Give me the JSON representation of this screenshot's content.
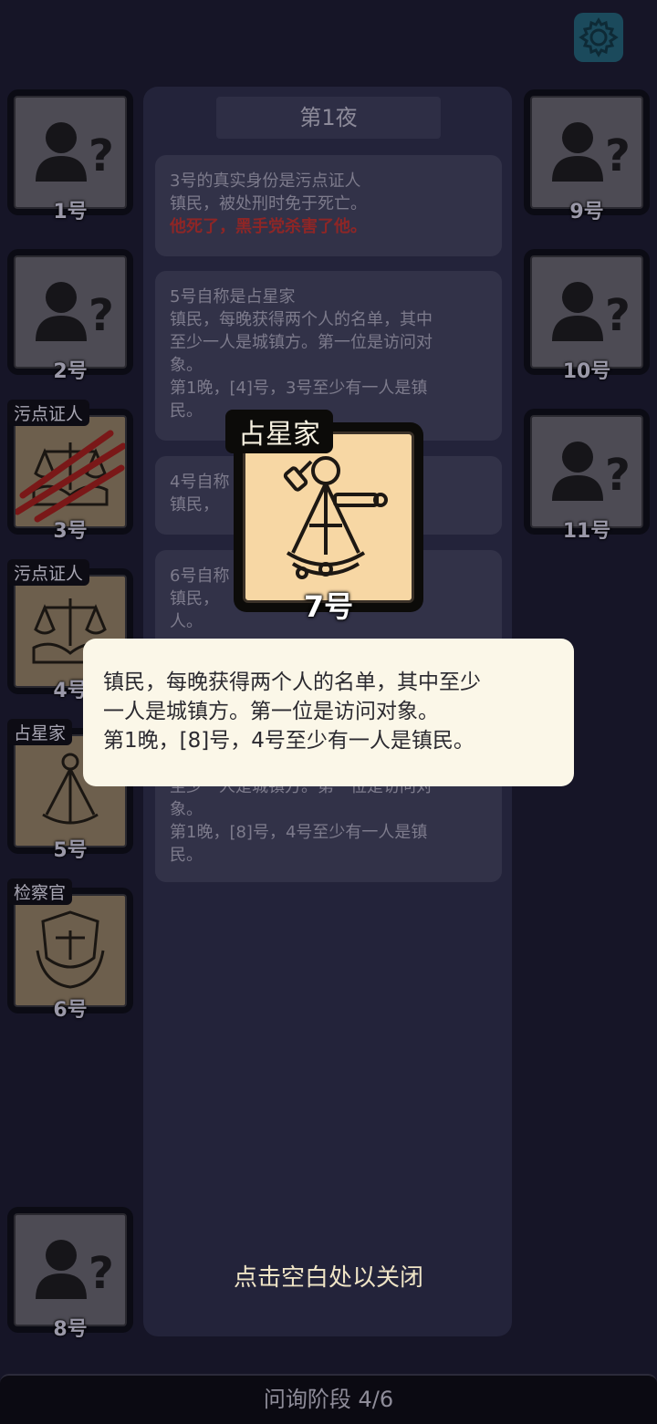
{
  "settings": {
    "icon": "gear-icon",
    "color": "#1b4a5c"
  },
  "night_title": "第1夜",
  "messages": [
    {
      "lines": [
        "3号的真实身份是污点证人",
        "镇民，被处刑时免于死亡。"
      ],
      "highlight": "他死了，黑手党杀害了他。"
    },
    {
      "lines": [
        "5号自称是占星家",
        "镇民，每晚获得两个人的名单，其中",
        "至少一人是城镇方。第一位是访问对",
        "象。",
        "第1晚，[4]号，3号至少有一人是镇",
        "民。"
      ]
    },
    {
      "lines": [
        "4号自称",
        "镇民，"
      ]
    },
    {
      "lines": [
        "6号自称",
        "镇民，",
        "人。"
      ]
    },
    {
      "lines": [
        "至少一人是城镇方。第一位是访问对",
        "象。",
        "第1晚，[8]号，4号至少有一人是镇",
        "民。"
      ]
    }
  ],
  "players": {
    "p1": {
      "num": "1号",
      "icon": "unknown-player-icon"
    },
    "p2": {
      "num": "2号",
      "icon": "unknown-player-icon"
    },
    "p3": {
      "num": "3号",
      "role": "污点证人",
      "icon": "witness-icon",
      "status": "dead"
    },
    "p4": {
      "num": "4号",
      "role": "污点证人",
      "icon": "witness-icon"
    },
    "p5": {
      "num": "5号",
      "role": "占星家",
      "icon": "sextant-icon"
    },
    "p6": {
      "num": "6号",
      "role": "检察官",
      "icon": "prosecutor-icon"
    },
    "p8": {
      "num": "8号",
      "icon": "unknown-player-icon"
    },
    "p9": {
      "num": "9号",
      "icon": "unknown-player-icon"
    },
    "p10": {
      "num": "10号",
      "icon": "unknown-player-icon"
    },
    "p11": {
      "num": "11号",
      "icon": "unknown-player-icon"
    }
  },
  "popup": {
    "role": "占星家",
    "num": "7号",
    "icon": "sextant-icon",
    "desc": [
      "镇民，每晚获得两个人的名单，其中至少",
      "一人是城镇方。第一位是访问对象。",
      "第1晚，[8]号，4号至少有一人是镇民。"
    ],
    "close_hint": "点击空白处以关闭"
  },
  "phase": "问询阶段 4/6"
}
